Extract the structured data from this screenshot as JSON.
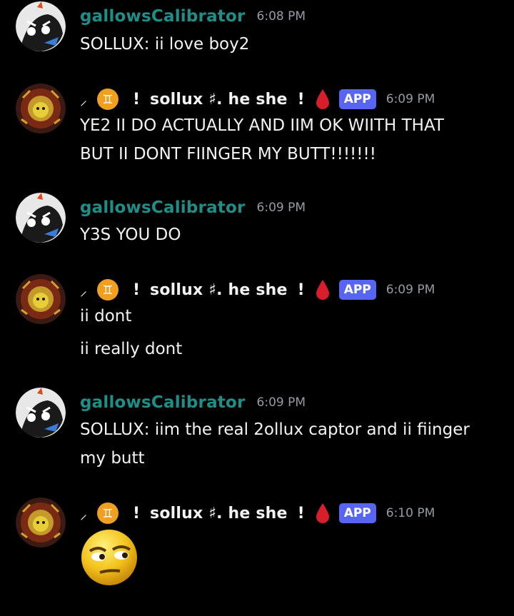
{
  "colors": {
    "background": "#000000",
    "gallows_name": "#1e8f86",
    "text": "#f2f3f5",
    "timestamp": "#949ba4",
    "app_badge": "#5865f2"
  },
  "users": {
    "gallows": {
      "name": "gallowsCalibrator"
    },
    "sollux": {
      "prefix": "⸝",
      "bang_left": "!",
      "name": "sollux ♯. he she",
      "bang_right": "!",
      "badge": "APP"
    }
  },
  "messages": [
    {
      "author": "gallowsCalibrator",
      "time": "6:08 PM",
      "lines": [
        "SOLLUX: ii love boy2"
      ]
    },
    {
      "author": "sollux",
      "time": "6:09 PM",
      "lines": [
        "YE2 II DO ACTUALLY AND IIM OK WIITH THAT",
        "BUT II DONT FIINGER MY BUTT!!!!!!!"
      ]
    },
    {
      "author": "gallowsCalibrator",
      "time": "6:09 PM",
      "lines": [
        "Y3S YOU DO"
      ]
    },
    {
      "author": "sollux",
      "time": "6:09 PM",
      "lines": [
        "ii dont",
        "ii really dont"
      ]
    },
    {
      "author": "gallowsCalibrator",
      "time": "6:09 PM",
      "lines": [
        "SOLLUX: iim the real 2ollux captor and ii fiinger",
        "my butt"
      ]
    },
    {
      "author": "sollux",
      "time": "6:10 PM",
      "lines": [],
      "emoji": "suspicious-face-emoji"
    }
  ]
}
